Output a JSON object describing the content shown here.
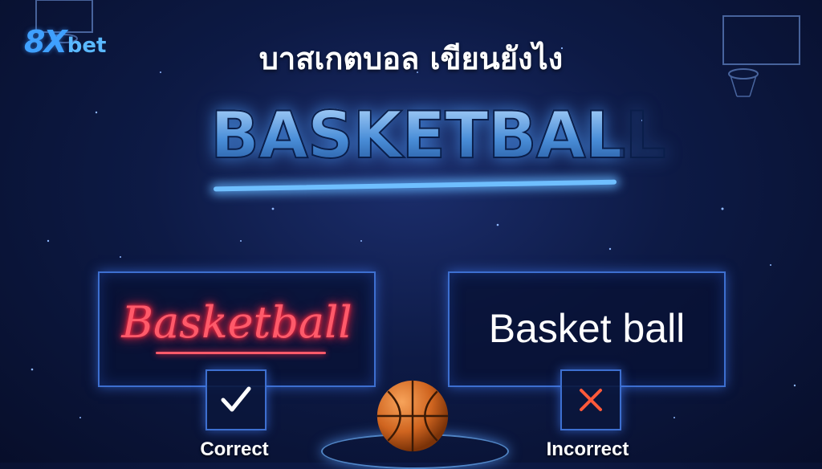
{
  "brand": {
    "logo_main": "8X",
    "logo_suffix": "bet"
  },
  "header": {
    "title": "บาสเกตบอล เขียนยังไง"
  },
  "hero": {
    "word": "BASKETBALL"
  },
  "options": [
    {
      "word": "Basketball",
      "label": "Correct",
      "mark": "check-icon",
      "accent": "#ff3a50"
    },
    {
      "word": "Basket ball",
      "label": "Incorrect",
      "mark": "cross-icon",
      "accent": "#ff4a3a"
    }
  ],
  "colors": {
    "background": "#0d1a45",
    "frame": "#3d6fd0",
    "brand": "#3fa0ff"
  }
}
